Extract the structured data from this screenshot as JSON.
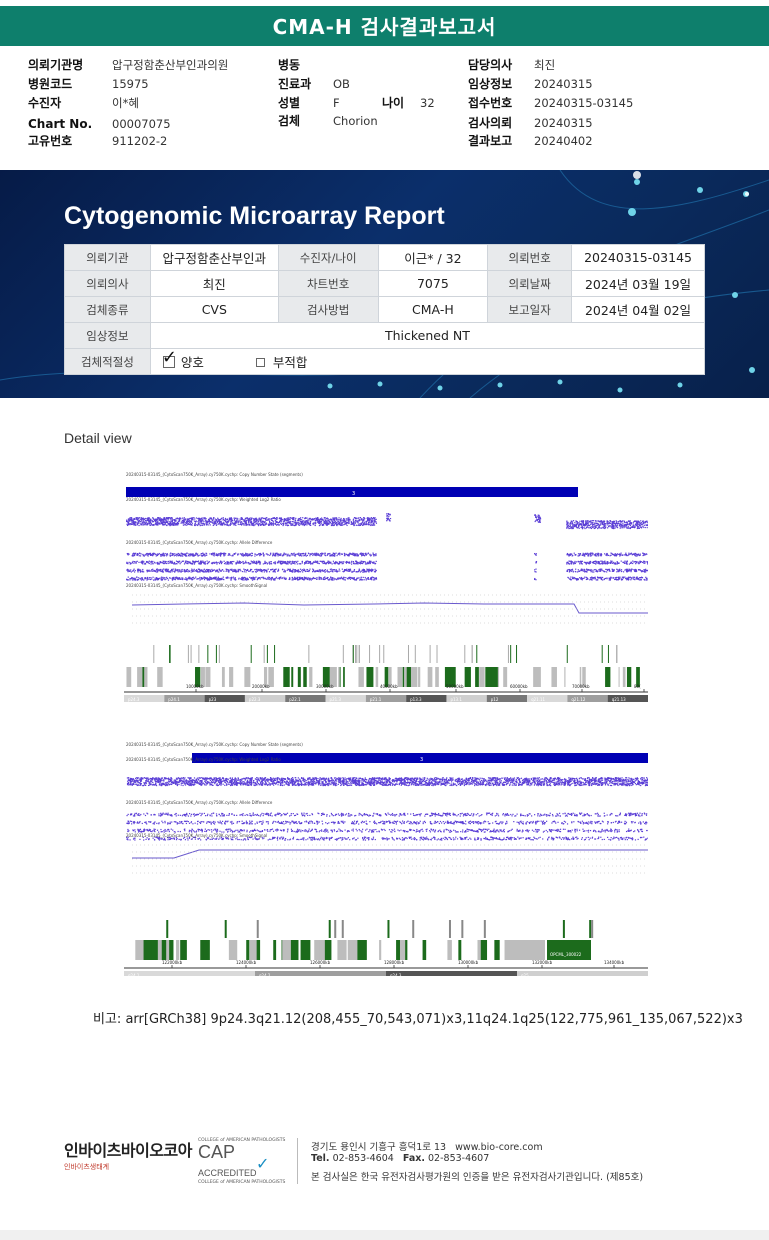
{
  "header": {
    "title": "CMA-H 검사결과보고서"
  },
  "info": {
    "hospital_label": "의뢰기관명",
    "hospital": "압구정함춘산부인과의원",
    "code_label": "병원코드",
    "code": "15975",
    "patient_label": "수진자",
    "patient": "이*혜",
    "chart_label": "Chart No.",
    "chart": "00007075",
    "uid_label": "고유번호",
    "uid": "911202-2",
    "ward_label": "병동",
    "ward": "",
    "dept_label": "진료과",
    "dept": "OB",
    "sex_label": "성별",
    "sex": "F",
    "age_label": "나이",
    "age": "32",
    "specimen_label": "검체",
    "specimen": "Chorion",
    "doctor_label": "담당의사",
    "doctor": "최진",
    "clinical_label": "임상정보",
    "clinical": "20240315",
    "receipt_label": "접수번호",
    "receipt": "20240315-03145",
    "request_label": "검사의뢰",
    "request": "20240315",
    "report_label": "결과보고",
    "report": "20240402"
  },
  "report": {
    "title": "Cytogenomic Microarray Report",
    "rows": [
      [
        "의뢰기관",
        "압구정함춘산부인과",
        "수진자/나이",
        "이근* / 32",
        "의뢰번호",
        "20240315-03145"
      ],
      [
        "의뢰의사",
        "최진",
        "차트번호",
        "7075",
        "의뢰날짜",
        "2024년 03월 19일"
      ],
      [
        "검체종류",
        "CVS",
        "검사방법",
        "CMA-H",
        "보고일자",
        "2024년 04월 02일"
      ]
    ],
    "clinical_label": "임상정보",
    "clinical_value": "Thickened NT",
    "suitability_label": "검체적절성",
    "suitable": "양호",
    "unsuitable": "부적합"
  },
  "detail": {
    "title": "Detail view"
  },
  "plot1": {
    "track_labels": [
      "20240315-03145_(CytoScan750K_Array).cy750K.cychp: Copy Number State (segments)",
      "20240315-03145_(CytoScan750K_Array).cy750K.cychp: Weighted Log2 Ratio",
      "20240315-03145_(CytoScan750K_Array).cy750K.cychp: Allele Difference",
      "20240315-03145_(CytoScan750K_Array).cy750K.cychp: SmoothSignal"
    ],
    "segment_label": "3",
    "axis_ticks": [
      "10000kb",
      "20000kb",
      "30000kb",
      "40000kb",
      "50000kb",
      "60000kb",
      "70000kb",
      "80("
    ],
    "bands": [
      "p24.3",
      "p24.1",
      "p23",
      "p22.3",
      "p22.1",
      "p21.3",
      "p21.1",
      "p13.3",
      "p13.1",
      "p12",
      "q21.11",
      "q21.12",
      "q21.13"
    ]
  },
  "plot2": {
    "track_labels": [
      "20240315-03145_(CytoScan750K_Array).cy750K.cychp: Copy Number State (segments)",
      "20240315-03145_(CytoScan750K_Array).cy750K.cychp: Weighted Log2 Ratio",
      "20240315-03145_(CytoScan750K_Array).cy750K.cychp: Allele Difference",
      "20240315-03145_(CytoScan750K_Array).cy750K.cychp: SmoothSignal"
    ],
    "segment_label": "3",
    "gene_label": "OPCML_300022",
    "axis_ticks": [
      "122000kb",
      "124000kb",
      "126000kb",
      "128000kb",
      "130000kb",
      "132000kb",
      "134000kb"
    ],
    "bands": [
      "q24.1",
      "q24.2",
      "q24.3",
      "q25"
    ]
  },
  "remark": {
    "label": "비고:",
    "text": "arr[GRCh38] 9p24.3q21.12(208,455_70,543,071)x3,11q24.1q25(122,775,961_135,067,522)x3"
  },
  "footer": {
    "brand": "인바이츠바이오코아",
    "brand_sub": "인바이츠생태계",
    "cap_top": "COLLEGE of AMERICAN PATHOLOGISTS",
    "cap": "CAP",
    "cap_acc": "ACCREDITED",
    "cap_bottom": "COLLEGE of AMERICAN PATHOLOGISTS",
    "address": "경기도 용인시 기흥구 흥덕1로 13",
    "website": "www.bio-core.com",
    "tel_label": "Tel.",
    "tel": "02-853-4604",
    "fax_label": "Fax.",
    "fax": "02-853-4607",
    "certification": "본 검사실은 한국 유전자검사평가원의 인증을 받은 유전자검사기관입니다. (제85호)"
  },
  "colors": {
    "title_bar": "#0e7f6c",
    "banner": "#0b2f6b",
    "segment": "#0000b4",
    "points": "#5b3fd6",
    "gene_green": "#1c6b1c"
  }
}
